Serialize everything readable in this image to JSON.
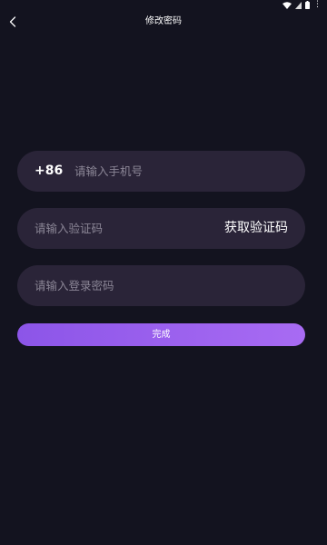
{
  "header": {
    "title": "修改密码",
    "back_icon": "chevron-left-icon"
  },
  "status_bar": {
    "icons": [
      "wifi-icon",
      "signal-icon",
      "battery-icon",
      "more-icon"
    ]
  },
  "form": {
    "phone": {
      "country_code": "+86",
      "value": "",
      "placeholder": "请输入手机号"
    },
    "code": {
      "value": "",
      "placeholder": "请输入验证码",
      "get_code_label": "获取验证码"
    },
    "password": {
      "value": "",
      "placeholder": "请输入登录密码"
    },
    "submit_label": "完成"
  },
  "colors": {
    "background": "#13131f",
    "field_background": "#2a2438",
    "placeholder": "#8b8696",
    "button_gradient_start": "#8c55e8",
    "button_gradient_end": "#a86bf3"
  }
}
